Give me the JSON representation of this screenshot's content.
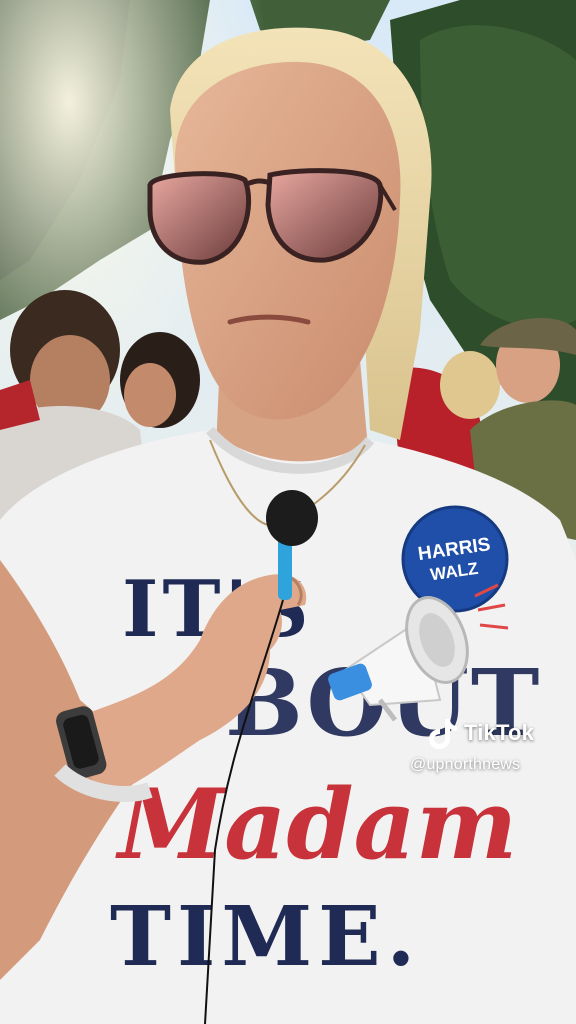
{
  "watermark": {
    "brand": "TikTok",
    "handle": "@upnorthnews",
    "logo_icon": "tiktok-logo-icon"
  },
  "shirt": {
    "line1": "IT'S",
    "line2": "BOUT",
    "line3": "Madam",
    "line4": "TIME."
  },
  "badge": {
    "line1": "HARRIS",
    "line2": "WALZ"
  },
  "colors": {
    "sky": "#cfe3f5",
    "shirt": "#f2f2f2",
    "navy": "#1f2a55",
    "red": "#c8323a",
    "badge": "#1f4fa8"
  }
}
